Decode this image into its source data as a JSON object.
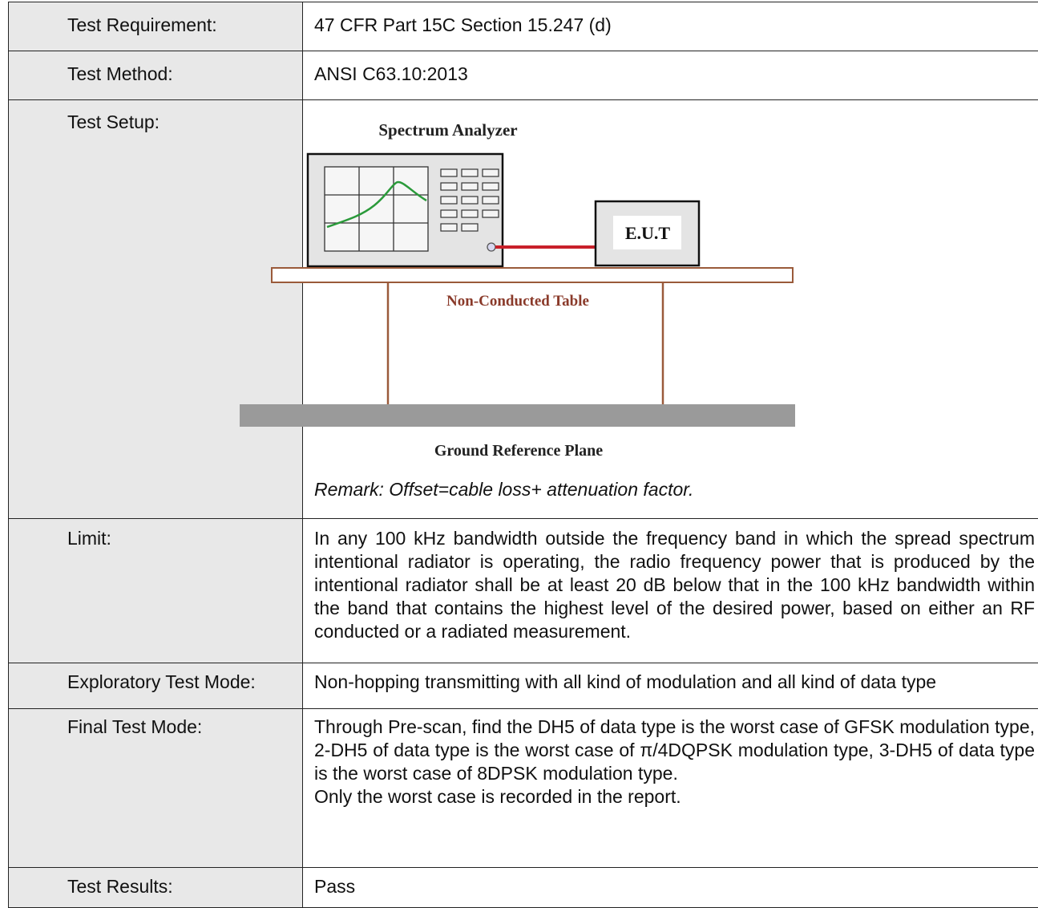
{
  "rows": {
    "requirement": {
      "label": "Test Requirement:",
      "value": "47 CFR Part 15C Section 15.247 (d)"
    },
    "method": {
      "label": "Test Method:",
      "value": "ANSI C63.10:2013"
    },
    "setup": {
      "label": "Test Setup:",
      "diagram": {
        "analyzer_label": "Spectrum Analyzer",
        "eut_label": "E.U.T",
        "table_label": "Non-Conducted Table",
        "ground_label": "Ground Reference Plane"
      },
      "remark": "Remark: Offset=cable loss+ attenuation factor."
    },
    "limit": {
      "label": "Limit:",
      "value": "In any 100 kHz bandwidth outside the frequency band in which the spread spectrum intentional radiator is operating, the radio frequency power that is produced by the intentional radiator shall be at least 20 dB below that in the 100 kHz bandwidth within the band that contains the highest level of the desired power, based on either an RF conducted or a radiated measurement."
    },
    "exploratory": {
      "label": "Exploratory Test Mode:",
      "value": "Non-hopping transmitting with all kind of modulation and all kind of data type"
    },
    "final": {
      "label": "Final Test Mode:",
      "value": "Through Pre-scan, find the DH5 of data type is the worst case of GFSK modulation type, 2-DH5 of data type is the worst case of π/4DQPSK modulation type, 3-DH5 of data type is the worst case of 8DPSK modulation type.",
      "note": "Only the worst case is recorded in the report."
    },
    "results": {
      "label": "Test Results:",
      "value": "Pass"
    }
  },
  "colors": {
    "label_bg": "#e8e8e8",
    "trace": "#2a9a3a",
    "cable": "#c8202a",
    "table_line": "#9a5a3a",
    "table_text": "#8a3a2a",
    "ground": "#9a9a9a",
    "device_bg": "#e4e4e4"
  }
}
